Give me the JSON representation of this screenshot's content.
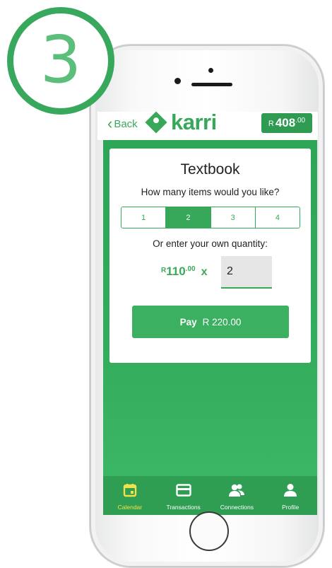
{
  "step": {
    "number": "3"
  },
  "header": {
    "back_label": "Back",
    "brand": "karri",
    "balance": {
      "currency": "R",
      "amount": "408",
      "cents": ".00"
    }
  },
  "card": {
    "title": "Textbook",
    "question": "How many items would you like?",
    "options": [
      "1",
      "2",
      "3",
      "4"
    ],
    "selected_option": "2",
    "own_quantity_label": "Or enter your own quantity:",
    "unit_price": {
      "currency": "R",
      "amount": "110",
      "cents": ".00"
    },
    "multiply_symbol": "x",
    "quantity_value": "2",
    "pay_label": "Pay",
    "pay_amount": "R 220.00"
  },
  "tabs": [
    {
      "label": "Calendar",
      "icon": "calendar-icon",
      "active": true
    },
    {
      "label": "Transactions",
      "icon": "card-icon",
      "active": false
    },
    {
      "label": "Connections",
      "icon": "people-icon",
      "active": false
    },
    {
      "label": "Profile",
      "icon": "person-icon",
      "active": false
    }
  ],
  "colors": {
    "accent": "#37a85a",
    "active_tab": "#f1e24a",
    "step_ring": "#38a85d"
  }
}
